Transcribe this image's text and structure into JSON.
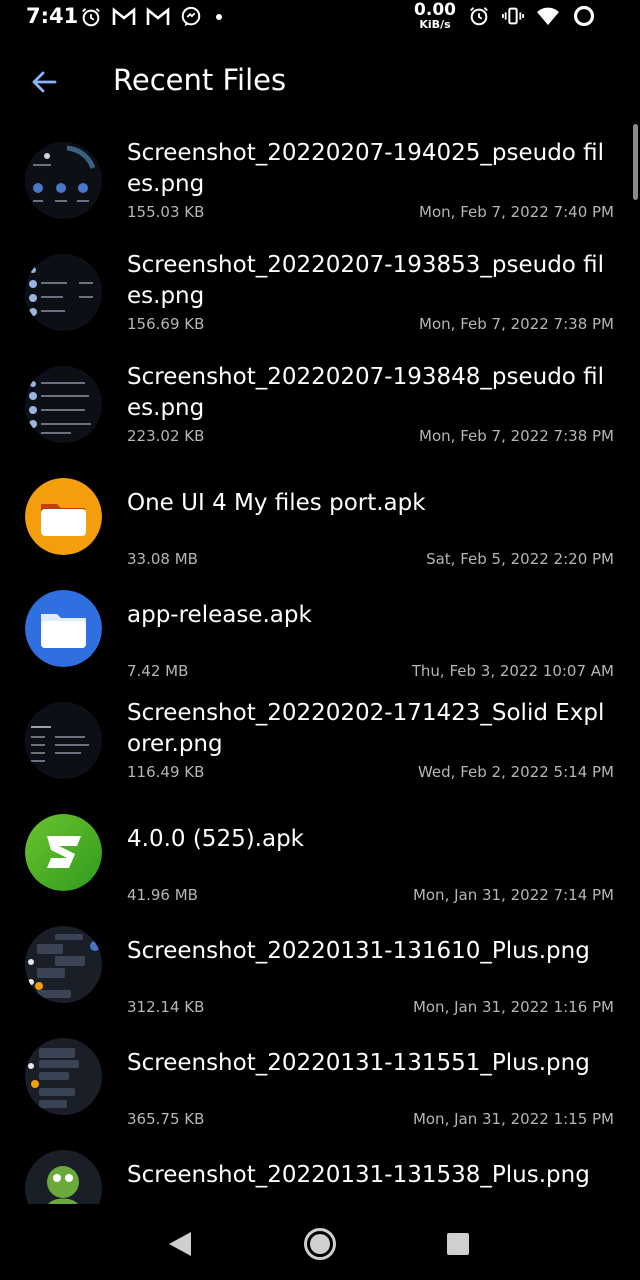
{
  "status_bar": {
    "time": "7:41",
    "net_speed_value": "0.00",
    "net_speed_unit": "KiB/s",
    "icons_left": [
      "alarm-icon",
      "gmail-icon",
      "gmail-icon",
      "messenger-icon",
      "dot-icon"
    ],
    "icons_right": [
      "alarm-icon",
      "vibrate-icon",
      "wifi-icon",
      "battery-ring-icon"
    ]
  },
  "toolbar": {
    "title": "Recent Files",
    "back_icon": "arrow-left-icon",
    "accent": "#8ab4f8"
  },
  "files": [
    {
      "name": "Screenshot_20220207-194025_pseudo files.png",
      "size": "155.03 KB",
      "date": "Mon, Feb 7, 2022 7:40 PM",
      "thumb": "screenshot-thumb"
    },
    {
      "name": "Screenshot_20220207-193853_pseudo files.png",
      "size": "156.69 KB",
      "date": "Mon, Feb 7, 2022 7:38 PM",
      "thumb": "screenshot-thumb"
    },
    {
      "name": "Screenshot_20220207-193848_pseudo files.png",
      "size": "223.02 KB",
      "date": "Mon, Feb 7, 2022 7:38 PM",
      "thumb": "screenshot-thumb"
    },
    {
      "name": "One UI 4 My files port.apk",
      "size": "33.08 MB",
      "date": "Sat, Feb 5, 2022 2:20 PM",
      "thumb": "orange-folder-app-icon"
    },
    {
      "name": "app-release.apk",
      "size": "7.42 MB",
      "date": "Thu, Feb 3, 2022 10:07 AM",
      "thumb": "blue-folder-app-icon"
    },
    {
      "name": "Screenshot_20220202-171423_Solid Explorer.png",
      "size": "116.49 KB",
      "date": "Wed, Feb 2, 2022 5:14 PM",
      "thumb": "screenshot-thumb"
    },
    {
      "name": "4.0.0 (525).apk",
      "size": "41.96 MB",
      "date": "Mon, Jan 31, 2022 7:14 PM",
      "thumb": "green-app-icon"
    },
    {
      "name": "Screenshot_20220131-131610_Plus.png",
      "size": "312.14 KB",
      "date": "Mon, Jan 31, 2022 1:16 PM",
      "thumb": "screenshot-thumb"
    },
    {
      "name": "Screenshot_20220131-131551_Plus.png",
      "size": "365.75 KB",
      "date": "Mon, Jan 31, 2022 1:15 PM",
      "thumb": "screenshot-thumb"
    },
    {
      "name": "Screenshot_20220131-131538_Plus.png",
      "size": "",
      "date": "",
      "thumb": "screenshot-thumb"
    }
  ],
  "colors": {
    "background": "#000000",
    "text_primary": "#ffffff",
    "text_secondary": "#b5b5b5",
    "orange": "#f59e0b",
    "blue": "#2f6fe0",
    "green": "#44b02a"
  },
  "nav_bar": {
    "back": "triangle-back-icon",
    "home": "circle-home-icon",
    "recents": "square-recents-icon"
  }
}
